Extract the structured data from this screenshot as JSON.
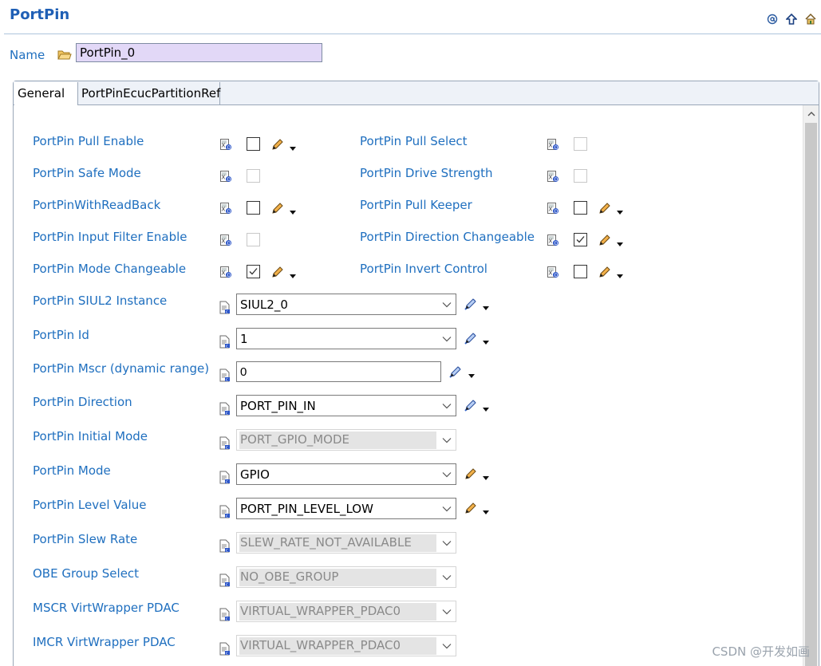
{
  "header": {
    "title": "PortPin",
    "icons": [
      "at-icon",
      "up-arrow-icon",
      "home-icon"
    ]
  },
  "name_field": {
    "label": "Name",
    "value": "PortPin_0"
  },
  "tabs": [
    {
      "label": "General",
      "active": true
    },
    {
      "label": "PortPinEcucPartitionRef",
      "active": false
    }
  ],
  "checkbox_params": {
    "left": [
      {
        "label": "PortPin Pull Enable",
        "checked": false,
        "enabled": true
      },
      {
        "label": "PortPin Safe Mode",
        "checked": false,
        "enabled": false
      },
      {
        "label": "PortPinWithReadBack",
        "checked": false,
        "enabled": true
      },
      {
        "label": "PortPin Input Filter Enable",
        "checked": false,
        "enabled": false
      },
      {
        "label": "PortPin Mode Changeable",
        "checked": true,
        "enabled": true
      }
    ],
    "right": [
      {
        "label": "PortPin Pull Select",
        "checked": false,
        "enabled": false
      },
      {
        "label": "PortPin Drive Strength",
        "checked": false,
        "enabled": false
      },
      {
        "label": "PortPin Pull Keeper",
        "checked": false,
        "enabled": true
      },
      {
        "label": "PortPin Direction Changeable",
        "checked": true,
        "enabled": true
      },
      {
        "label": "PortPin Invert Control",
        "checked": false,
        "enabled": true
      }
    ]
  },
  "value_params": [
    {
      "label": "PortPin SIUL2 Instance",
      "value": "SIUL2_0",
      "kind": "combo",
      "enabled": true,
      "edit_icon": "blue-pencil"
    },
    {
      "label": "PortPin Id",
      "value": "1",
      "kind": "combo",
      "enabled": true,
      "edit_icon": "blue-pencil"
    },
    {
      "label": "PortPin Mscr (dynamic range)",
      "value": "0",
      "kind": "text",
      "enabled": true,
      "edit_icon": "blue-pencil"
    },
    {
      "label": "PortPin Direction",
      "value": "PORT_PIN_IN",
      "kind": "combo",
      "enabled": true,
      "edit_icon": "blue-pencil"
    },
    {
      "label": "PortPin Initial Mode",
      "value": "PORT_GPIO_MODE",
      "kind": "combo",
      "enabled": false
    },
    {
      "label": "PortPin Mode",
      "value": "GPIO",
      "kind": "combo",
      "enabled": true,
      "edit_icon": "pencil"
    },
    {
      "label": "PortPin Level Value",
      "value": "PORT_PIN_LEVEL_LOW",
      "kind": "combo",
      "enabled": true,
      "edit_icon": "pencil"
    },
    {
      "label": "PortPin Slew Rate",
      "value": "SLEW_RATE_NOT_AVAILABLE",
      "kind": "combo",
      "enabled": false
    },
    {
      "label": "OBE Group Select",
      "value": "NO_OBE_GROUP",
      "kind": "combo",
      "enabled": false
    },
    {
      "label": "MSCR VirtWrapper PDAC",
      "value": "VIRTUAL_WRAPPER_PDAC0",
      "kind": "combo",
      "enabled": false
    },
    {
      "label": "IMCR VirtWrapper PDAC",
      "value": "VIRTUAL_WRAPPER_PDAC0",
      "kind": "combo",
      "enabled": false
    }
  ],
  "watermark": "CSDN @开发如画",
  "colors": {
    "label": "#1f6fbf",
    "title": "#1f5fb5",
    "name_input_bg": "#e2d8f7",
    "disabled_bg": "#e4e4e4"
  }
}
